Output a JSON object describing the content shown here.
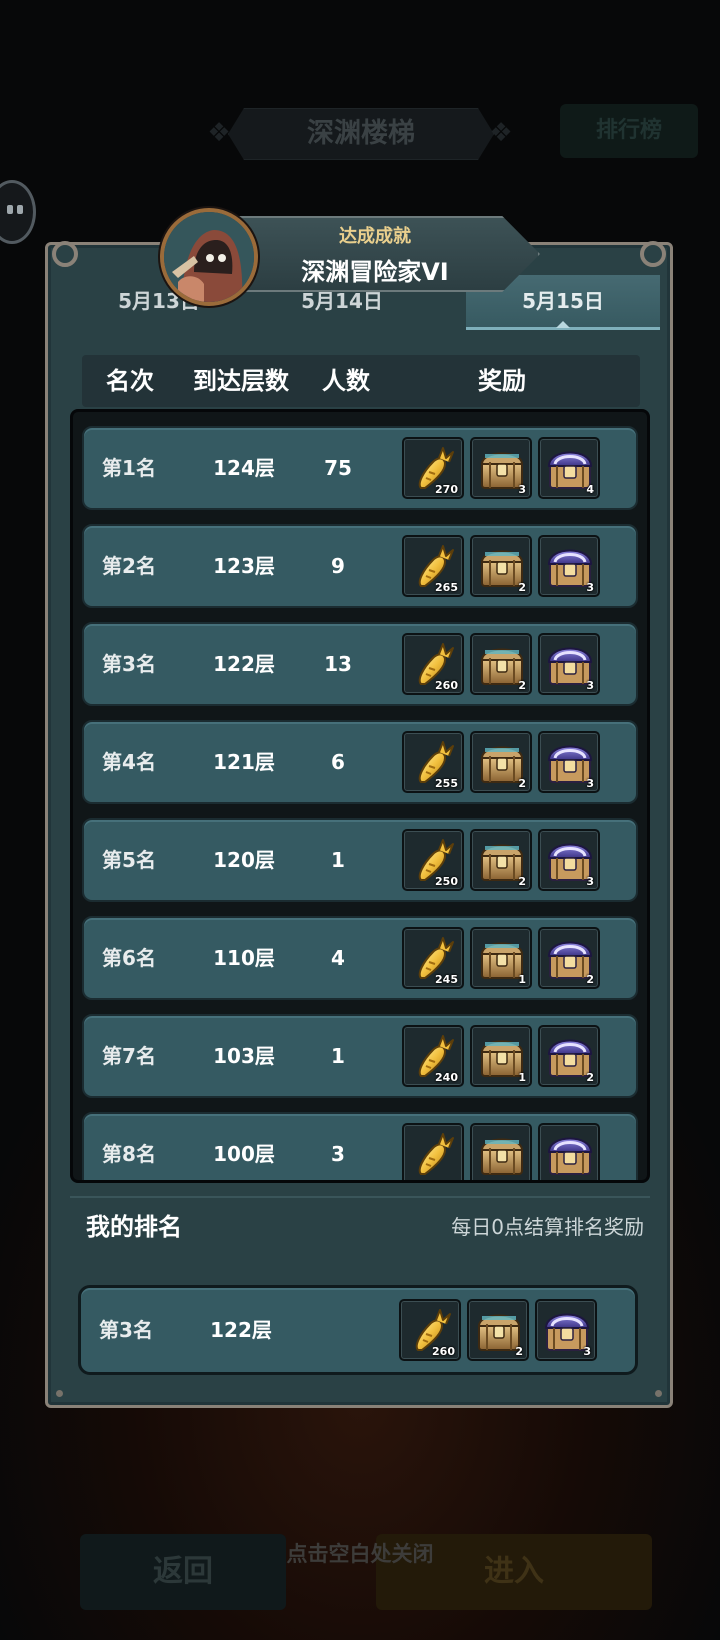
{
  "background": {
    "title": "深渊楼梯",
    "ranking_button": "排行榜",
    "back_button": "返回",
    "enter_button": "进入",
    "close_hint": "点击空白处关闭"
  },
  "achievement": {
    "label": "达成成就",
    "title": "深渊冒险家VI"
  },
  "tabs": [
    {
      "label": "5月13日",
      "selected": false
    },
    {
      "label": "5月14日",
      "selected": false
    },
    {
      "label": "5月15日",
      "selected": true
    }
  ],
  "table": {
    "headers": {
      "rank": "名次",
      "floor": "到达层数",
      "count": "人数",
      "reward": "奖励"
    },
    "rows": [
      {
        "rank": "第1名",
        "floor": "124层",
        "count": "75",
        "carrot": "270",
        "chest_gold": "3",
        "chest_purple": "4"
      },
      {
        "rank": "第2名",
        "floor": "123层",
        "count": "9",
        "carrot": "265",
        "chest_gold": "2",
        "chest_purple": "3"
      },
      {
        "rank": "第3名",
        "floor": "122层",
        "count": "13",
        "carrot": "260",
        "chest_gold": "2",
        "chest_purple": "3"
      },
      {
        "rank": "第4名",
        "floor": "121层",
        "count": "6",
        "carrot": "255",
        "chest_gold": "2",
        "chest_purple": "3"
      },
      {
        "rank": "第5名",
        "floor": "120层",
        "count": "1",
        "carrot": "250",
        "chest_gold": "2",
        "chest_purple": "3"
      },
      {
        "rank": "第6名",
        "floor": "110层",
        "count": "4",
        "carrot": "245",
        "chest_gold": "1",
        "chest_purple": "2"
      },
      {
        "rank": "第7名",
        "floor": "103层",
        "count": "1",
        "carrot": "240",
        "chest_gold": "1",
        "chest_purple": "2"
      },
      {
        "rank": "第8名",
        "floor": "100层",
        "count": "3",
        "carrot": "",
        "chest_gold": "",
        "chest_purple": ""
      }
    ]
  },
  "my_rank": {
    "title": "我的排名",
    "hint": "每日0点结算排名奖励",
    "rank": "第3名",
    "floor": "122层",
    "carrot": "260",
    "chest_gold": "2",
    "chest_purple": "3"
  },
  "icons": {
    "carrot": "golden-carrot-icon",
    "chest_gold": "gold-treasure-chest-icon",
    "chest_purple": "purple-treasure-chest-icon",
    "avatar": "hooded-adventurer-avatar"
  },
  "colors": {
    "panel": "#2a4145",
    "row": "#355a62",
    "accent_gold": "#e9cf8d",
    "selected_tab": "#466a72"
  }
}
